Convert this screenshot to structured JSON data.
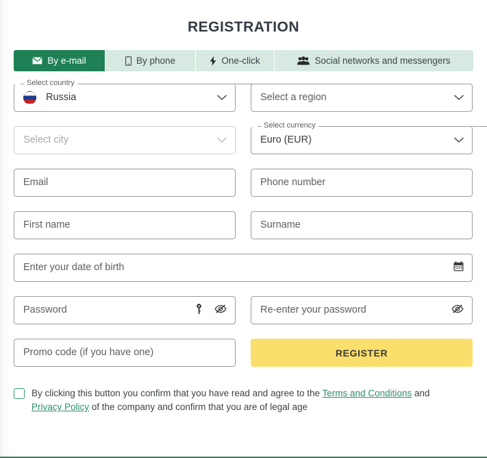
{
  "page": {
    "title": "REGISTRATION"
  },
  "tabs": [
    {
      "label": "By e-mail",
      "icon": "envelope-icon",
      "active": true
    },
    {
      "label": "By phone",
      "icon": "mobile-phone-icon",
      "active": false
    },
    {
      "label": "One-click",
      "icon": "lightning-bolt-icon",
      "active": false
    },
    {
      "label": "Social networks and messengers",
      "icon": "people-group-icon",
      "active": false
    }
  ],
  "fields": {
    "country": {
      "label": "Select country",
      "value": "Russia",
      "flag": "russia-flag-icon",
      "chevron": "chevron-down-icon"
    },
    "region": {
      "placeholder": "Select a region",
      "chevron": "chevron-down-icon"
    },
    "city": {
      "placeholder": "Select city",
      "chevron": "chevron-down-icon",
      "disabled": true
    },
    "currency": {
      "label": "Select currency",
      "value": "Euro (EUR)",
      "chevron": "chevron-down-icon"
    },
    "email": {
      "placeholder": "Email"
    },
    "phone": {
      "placeholder": "Phone number"
    },
    "first_name": {
      "placeholder": "First name"
    },
    "surname": {
      "placeholder": "Surname"
    },
    "date_of_birth": {
      "placeholder": "Enter your date of birth",
      "icon": "calendar-icon"
    },
    "password": {
      "placeholder": "Password",
      "key_icon": "key-icon",
      "toggle_icon": "eye-slash-icon"
    },
    "password_repeat": {
      "placeholder": "Re-enter your password",
      "toggle_icon": "eye-slash-icon"
    },
    "promo_code": {
      "placeholder": "Promo code (if you have one)"
    }
  },
  "register_button": {
    "label": "REGISTER"
  },
  "terms": {
    "checked": false,
    "text_before": "By clicking this button you confirm that you have read and agree to the ",
    "link_terms": "Terms and Conditions",
    "text_between": " and ",
    "link_privacy": "Privacy Policy",
    "text_after": " of the company and confirm that you are of legal age"
  },
  "colors": {
    "tab_active_bg": "#1f8055",
    "tab_inactive_bg": "#d7e9e0",
    "register_bg": "#fbdf6d",
    "link": "#2b8f6b",
    "checkbox_border": "#2f9b74",
    "bottom_rule": "#2d7d5a"
  }
}
